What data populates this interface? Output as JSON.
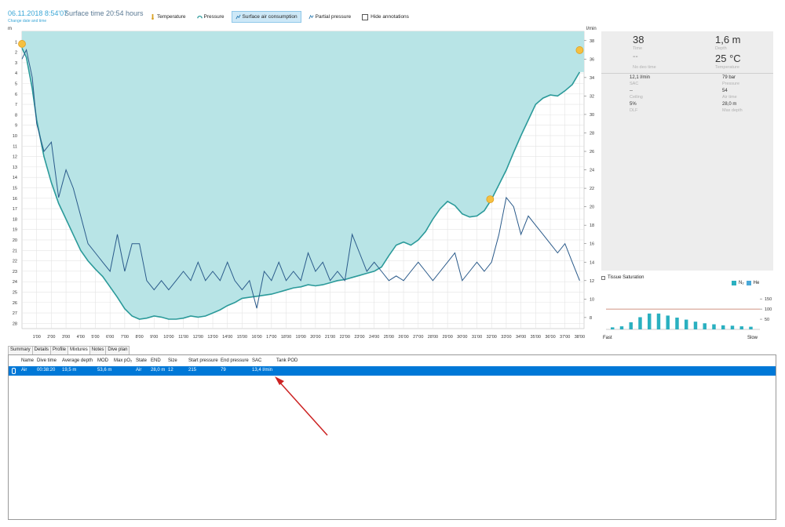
{
  "header": {
    "date": "06.11.2018 8:54'07",
    "surface_time": "Surface time 20:54 hours",
    "change_link": "Change date and time"
  },
  "toolbar": {
    "temperature": "Temperature",
    "pressure": "Pressure",
    "sac": "Surface air consumption",
    "partial_pressure": "Partial pressure",
    "hide_annotations": "Hide annotations"
  },
  "chart_data": {
    "type": "area",
    "left_axis_label": "m",
    "right_axis_label": "l/min",
    "y_left_ticks": [
      "1",
      "2",
      "3",
      "4",
      "5",
      "6",
      "7",
      "8",
      "9",
      "10",
      "11",
      "12",
      "13",
      "14",
      "15",
      "16",
      "17",
      "18",
      "19",
      "20",
      "21",
      "22",
      "23",
      "24",
      "25",
      "26",
      "27",
      "28"
    ],
    "y_right_ticks": [
      "38",
      "36",
      "34",
      "32",
      "30",
      "28",
      "26",
      "24",
      "22",
      "20",
      "18",
      "16",
      "14",
      "12",
      "10",
      "8"
    ],
    "x_ticks": [
      "1'00",
      "2'00",
      "3'00",
      "4'00",
      "5'00",
      "6'00",
      "7'00",
      "8'00",
      "9'00",
      "10'00",
      "11'00",
      "12'00",
      "13'00",
      "14'00",
      "15'00",
      "16'00",
      "17'00",
      "18'00",
      "19'00",
      "20'00",
      "21'00",
      "22'00",
      "23'00",
      "24'00",
      "25'00",
      "26'00",
      "27'00",
      "28'00",
      "29'00",
      "30'00",
      "31'00",
      "32'00",
      "33'00",
      "34'00",
      "35'00",
      "36'00",
      "37'00",
      "38'00"
    ],
    "ylim_depth": [
      0,
      28.5
    ],
    "ylim_sac": [
      6.8,
      39
    ],
    "xlim_min": [
      0,
      38.3
    ],
    "depth_series": {
      "name": "Depth",
      "x": [
        0,
        0.3,
        0.7,
        1,
        1.5,
        2,
        2.5,
        3,
        3.5,
        4,
        4.5,
        5,
        5.5,
        6,
        6.5,
        7,
        7.5,
        8,
        8.5,
        9,
        9.5,
        10,
        10.5,
        11,
        11.5,
        12,
        12.5,
        13,
        13.5,
        14,
        14.5,
        15,
        15.5,
        16,
        16.5,
        17,
        17.5,
        18,
        18.5,
        19,
        19.5,
        20,
        20.5,
        21,
        21.5,
        22,
        22.5,
        23,
        23.5,
        24,
        24.5,
        25,
        25.5,
        26,
        26.5,
        27,
        27.5,
        28,
        28.5,
        29,
        29.5,
        30,
        30.5,
        31,
        31.5,
        32,
        32.5,
        33,
        33.5,
        34,
        34.5,
        35,
        35.5,
        36,
        36.5,
        37,
        37.5,
        38
      ],
      "y": [
        1.6,
        2.5,
        5.5,
        8.5,
        12,
        14.5,
        16.5,
        18,
        19.5,
        21,
        22,
        22.8,
        23.5,
        24.5,
        25.5,
        26.6,
        27.3,
        27.6,
        27.5,
        27.3,
        27.4,
        27.6,
        27.6,
        27.5,
        27.3,
        27.4,
        27.3,
        27,
        26.7,
        26.3,
        26,
        25.6,
        25.5,
        25.4,
        25.3,
        25.2,
        25,
        24.8,
        24.6,
        24.5,
        24.3,
        24.4,
        24.3,
        24.1,
        23.9,
        23.8,
        23.6,
        23.4,
        23.2,
        23,
        22.6,
        21.5,
        20.5,
        20.2,
        20.5,
        20,
        19.2,
        18,
        17,
        16.3,
        16.7,
        17.5,
        17.8,
        17.7,
        17.2,
        16.1,
        14.7,
        13.3,
        11.6,
        10,
        8.5,
        7,
        6.4,
        6.1,
        6.2,
        5.7,
        5.1,
        3.9
      ]
    },
    "sac_series": {
      "name": "SAC",
      "x": [
        0,
        0.3,
        0.7,
        1,
        1.5,
        2,
        2.5,
        3,
        3.5,
        4,
        4.5,
        5,
        5.5,
        6,
        6.5,
        7,
        7.5,
        8,
        8.5,
        9,
        9.5,
        10,
        10.5,
        11,
        11.5,
        12,
        12.5,
        13,
        13.5,
        14,
        14.5,
        15,
        15.5,
        16,
        16.5,
        17,
        17.5,
        18,
        18.5,
        19,
        19.5,
        20,
        20.5,
        21,
        21.5,
        22,
        22.5,
        23,
        23.5,
        24,
        24.5,
        25,
        25.5,
        26,
        26.5,
        27,
        27.5,
        28,
        28.5,
        29,
        29.5,
        30,
        30.5,
        31,
        31.5,
        32,
        32.5,
        33,
        33.5,
        34,
        34.5,
        35,
        35.5,
        36,
        36.5,
        37,
        37.5,
        38
      ],
      "y": [
        36,
        37,
        34,
        29,
        26,
        27,
        21,
        24,
        22,
        19,
        16,
        15,
        14,
        13,
        17,
        13,
        16,
        16,
        12,
        11,
        12,
        11,
        12,
        13,
        12,
        14,
        12,
        13,
        12,
        14,
        12,
        11,
        12,
        9,
        13,
        12,
        14,
        12,
        13,
        12,
        15,
        13,
        14,
        12,
        13,
        12,
        17,
        15,
        13,
        14,
        13,
        12,
        12.5,
        12,
        13,
        14,
        13,
        12,
        13,
        14,
        15,
        12,
        13,
        14,
        13,
        14,
        17,
        21,
        20,
        17,
        19,
        18,
        17,
        16,
        15,
        16,
        14,
        12
      ]
    },
    "markers": [
      {
        "name": "start-marker",
        "x": 0,
        "depth": 1.2
      },
      {
        "name": "deco-marker",
        "x": 31.9,
        "depth": 16.1
      },
      {
        "name": "end-marker",
        "x": 38,
        "depth": 1.8
      }
    ]
  },
  "info_panel": {
    "time_value": "38",
    "time_label": "Time",
    "depth_value": "1,6 m",
    "depth_label": "Depth",
    "nodeco_value": "--",
    "nodeco_label": "No deo time",
    "temp_value": "25 °C",
    "temp_label": "Temperature",
    "sac_value": "12,1 l/min",
    "sac_label": "SAC",
    "pressure_value": "79 bar",
    "pressure_label": "Pressure",
    "ceiling_value": "--",
    "ceiling_label": "Ceiling",
    "airtime_value": "54",
    "airtime_label": "Air time",
    "dlf_value": "5%",
    "dlf_label": "DLF",
    "maxdepth_value": "28,0 m",
    "maxdepth_label": "Max depth"
  },
  "tissue": {
    "title": "Tissue Saturation",
    "legend_n2": "N₂",
    "legend_he": "He",
    "fast_label": "Fast",
    "slow_label": "Slow",
    "y_ticks": [
      "150",
      "100",
      "50"
    ],
    "n2_values": [
      10,
      15,
      35,
      60,
      78,
      78,
      68,
      58,
      48,
      38,
      30,
      25,
      20,
      18,
      15,
      13
    ],
    "limit_value": 100,
    "colors": {
      "n2": "#2ab0c0",
      "he": "#4aa8d8",
      "limit": "#c0705a"
    }
  },
  "tabs": [
    "Summary",
    "Details",
    "Profile",
    "Mixtures",
    "Notes",
    "Dive plan"
  ],
  "table": {
    "headers": [
      "Name",
      "Dive time",
      "Average depth",
      "MOD",
      "Max pO₂",
      "State",
      "END",
      "Size",
      "Start pressure",
      "End pressure",
      "SAC",
      "Tank POD"
    ],
    "row": [
      "Air",
      "00:38:20",
      "19,5 m",
      "53,6 m",
      "",
      "Air",
      "28,0 m",
      "12",
      "215",
      "79",
      "13,4 l/min",
      ""
    ]
  },
  "colors": {
    "accent": "#3aa6d6",
    "area_fill": "#b8e4e6",
    "depth_line": "#2b9a9a",
    "sac_line": "#2a5a8a",
    "selection": "#0078d7",
    "arrow": "#cc2222"
  }
}
